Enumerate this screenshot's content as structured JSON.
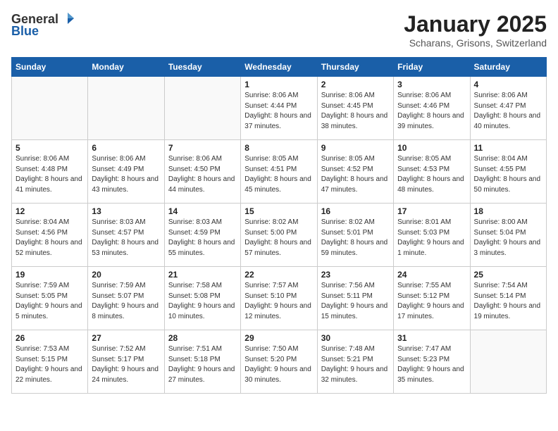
{
  "header": {
    "logo_general": "General",
    "logo_blue": "Blue",
    "title": "January 2025",
    "subtitle": "Scharans, Grisons, Switzerland"
  },
  "weekdays": [
    "Sunday",
    "Monday",
    "Tuesday",
    "Wednesday",
    "Thursday",
    "Friday",
    "Saturday"
  ],
  "weeks": [
    [
      {
        "day": "",
        "info": ""
      },
      {
        "day": "",
        "info": ""
      },
      {
        "day": "",
        "info": ""
      },
      {
        "day": "1",
        "info": "Sunrise: 8:06 AM\nSunset: 4:44 PM\nDaylight: 8 hours and 37 minutes."
      },
      {
        "day": "2",
        "info": "Sunrise: 8:06 AM\nSunset: 4:45 PM\nDaylight: 8 hours and 38 minutes."
      },
      {
        "day": "3",
        "info": "Sunrise: 8:06 AM\nSunset: 4:46 PM\nDaylight: 8 hours and 39 minutes."
      },
      {
        "day": "4",
        "info": "Sunrise: 8:06 AM\nSunset: 4:47 PM\nDaylight: 8 hours and 40 minutes."
      }
    ],
    [
      {
        "day": "5",
        "info": "Sunrise: 8:06 AM\nSunset: 4:48 PM\nDaylight: 8 hours and 41 minutes."
      },
      {
        "day": "6",
        "info": "Sunrise: 8:06 AM\nSunset: 4:49 PM\nDaylight: 8 hours and 43 minutes."
      },
      {
        "day": "7",
        "info": "Sunrise: 8:06 AM\nSunset: 4:50 PM\nDaylight: 8 hours and 44 minutes."
      },
      {
        "day": "8",
        "info": "Sunrise: 8:05 AM\nSunset: 4:51 PM\nDaylight: 8 hours and 45 minutes."
      },
      {
        "day": "9",
        "info": "Sunrise: 8:05 AM\nSunset: 4:52 PM\nDaylight: 8 hours and 47 minutes."
      },
      {
        "day": "10",
        "info": "Sunrise: 8:05 AM\nSunset: 4:53 PM\nDaylight: 8 hours and 48 minutes."
      },
      {
        "day": "11",
        "info": "Sunrise: 8:04 AM\nSunset: 4:55 PM\nDaylight: 8 hours and 50 minutes."
      }
    ],
    [
      {
        "day": "12",
        "info": "Sunrise: 8:04 AM\nSunset: 4:56 PM\nDaylight: 8 hours and 52 minutes."
      },
      {
        "day": "13",
        "info": "Sunrise: 8:03 AM\nSunset: 4:57 PM\nDaylight: 8 hours and 53 minutes."
      },
      {
        "day": "14",
        "info": "Sunrise: 8:03 AM\nSunset: 4:59 PM\nDaylight: 8 hours and 55 minutes."
      },
      {
        "day": "15",
        "info": "Sunrise: 8:02 AM\nSunset: 5:00 PM\nDaylight: 8 hours and 57 minutes."
      },
      {
        "day": "16",
        "info": "Sunrise: 8:02 AM\nSunset: 5:01 PM\nDaylight: 8 hours and 59 minutes."
      },
      {
        "day": "17",
        "info": "Sunrise: 8:01 AM\nSunset: 5:03 PM\nDaylight: 9 hours and 1 minute."
      },
      {
        "day": "18",
        "info": "Sunrise: 8:00 AM\nSunset: 5:04 PM\nDaylight: 9 hours and 3 minutes."
      }
    ],
    [
      {
        "day": "19",
        "info": "Sunrise: 7:59 AM\nSunset: 5:05 PM\nDaylight: 9 hours and 5 minutes."
      },
      {
        "day": "20",
        "info": "Sunrise: 7:59 AM\nSunset: 5:07 PM\nDaylight: 9 hours and 8 minutes."
      },
      {
        "day": "21",
        "info": "Sunrise: 7:58 AM\nSunset: 5:08 PM\nDaylight: 9 hours and 10 minutes."
      },
      {
        "day": "22",
        "info": "Sunrise: 7:57 AM\nSunset: 5:10 PM\nDaylight: 9 hours and 12 minutes."
      },
      {
        "day": "23",
        "info": "Sunrise: 7:56 AM\nSunset: 5:11 PM\nDaylight: 9 hours and 15 minutes."
      },
      {
        "day": "24",
        "info": "Sunrise: 7:55 AM\nSunset: 5:12 PM\nDaylight: 9 hours and 17 minutes."
      },
      {
        "day": "25",
        "info": "Sunrise: 7:54 AM\nSunset: 5:14 PM\nDaylight: 9 hours and 19 minutes."
      }
    ],
    [
      {
        "day": "26",
        "info": "Sunrise: 7:53 AM\nSunset: 5:15 PM\nDaylight: 9 hours and 22 minutes."
      },
      {
        "day": "27",
        "info": "Sunrise: 7:52 AM\nSunset: 5:17 PM\nDaylight: 9 hours and 24 minutes."
      },
      {
        "day": "28",
        "info": "Sunrise: 7:51 AM\nSunset: 5:18 PM\nDaylight: 9 hours and 27 minutes."
      },
      {
        "day": "29",
        "info": "Sunrise: 7:50 AM\nSunset: 5:20 PM\nDaylight: 9 hours and 30 minutes."
      },
      {
        "day": "30",
        "info": "Sunrise: 7:48 AM\nSunset: 5:21 PM\nDaylight: 9 hours and 32 minutes."
      },
      {
        "day": "31",
        "info": "Sunrise: 7:47 AM\nSunset: 5:23 PM\nDaylight: 9 hours and 35 minutes."
      },
      {
        "day": "",
        "info": ""
      }
    ]
  ]
}
